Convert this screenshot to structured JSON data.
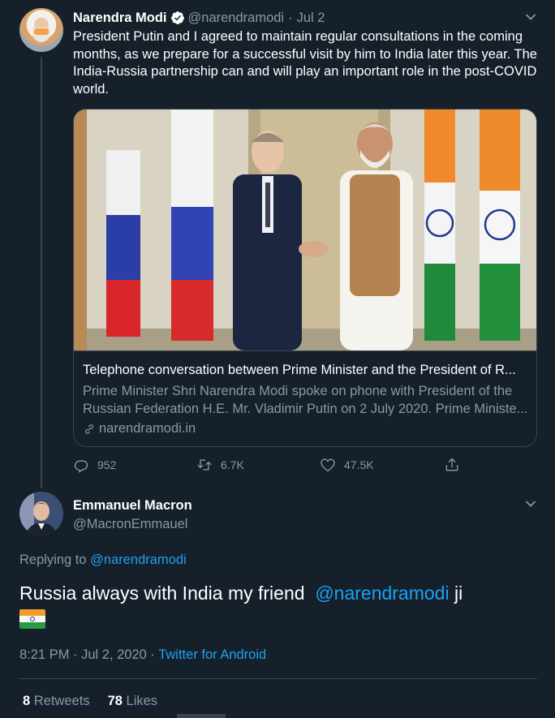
{
  "parent_tweet": {
    "author_name": "Narendra Modi",
    "handle": "@narendramodi",
    "separator": "·",
    "date": "Jul 2",
    "text": "President Putin and I agreed to maintain regular consultations in the coming months, as we prepare for a successful visit by him to India later this year. The India-Russia partnership can and will play an important role in the post-COVID world.",
    "card": {
      "title": "Telephone conversation between Prime Minister and the President of R...",
      "description": "Prime Minister Shri Narendra Modi spoke on phone with President of the Russian Federation H.E. Mr. Vladimir Putin on 2 July 2020. Prime Ministe...",
      "domain": "narendramodi.in"
    },
    "actions": {
      "replies": "952",
      "retweets": "6.7K",
      "likes": "47.5K"
    }
  },
  "reply_tweet": {
    "author_name": "Emmanuel Macron",
    "handle": "@MacronEmmauel",
    "replying_to_label": "Replying to",
    "replying_to_handle": "@narendramodi",
    "text_before": "Russia always with India my friend",
    "mention": "@narendramodi",
    "text_after": "ji",
    "flag_emoji": "india-flag",
    "timestamp": "8:21 PM · Jul 2, 2020 ·",
    "source": "Twitter for Android",
    "retweet_count": "8",
    "retweet_label": "Retweets",
    "like_count": "78",
    "like_label": "Likes"
  },
  "colors": {
    "background": "#15202b",
    "text": "#ffffff",
    "muted": "#8899a6",
    "accent": "#1da1f2",
    "border": "#38444d"
  },
  "icons": [
    "verified-badge-icon",
    "chevron-down-icon",
    "reply-icon",
    "retweet-icon",
    "like-icon",
    "share-icon",
    "link-icon"
  ]
}
